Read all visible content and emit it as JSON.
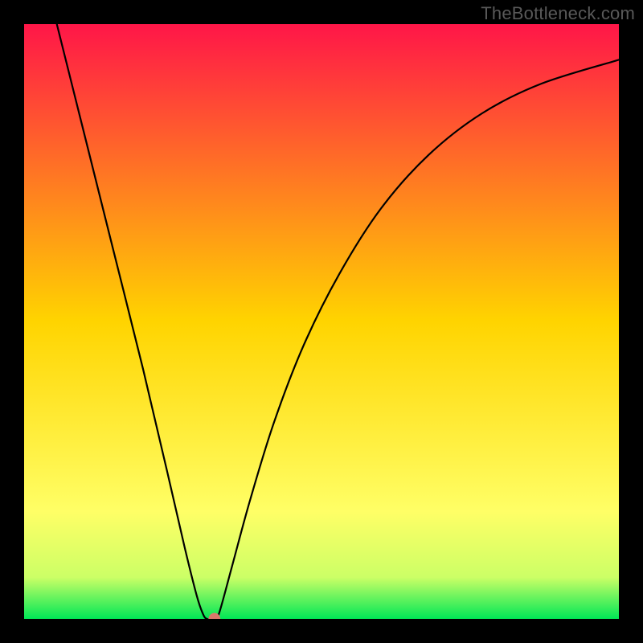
{
  "watermark": "TheBottleneck.com",
  "chart_data": {
    "type": "line",
    "title": "",
    "xlabel": "",
    "ylabel": "",
    "xlim": [
      0,
      1
    ],
    "ylim": [
      0,
      1
    ],
    "background_gradient": {
      "stops": [
        {
          "offset": 0.0,
          "color": "#ff1648"
        },
        {
          "offset": 0.5,
          "color": "#ffd400"
        },
        {
          "offset": 0.82,
          "color": "#ffff66"
        },
        {
          "offset": 0.93,
          "color": "#ccff66"
        },
        {
          "offset": 1.0,
          "color": "#00e756"
        }
      ]
    },
    "series": [
      {
        "name": "bottleneck-curve",
        "color": "#000000",
        "points": [
          {
            "x": 0.055,
            "y": 1.0
          },
          {
            "x": 0.1,
            "y": 0.82
          },
          {
            "x": 0.15,
            "y": 0.62
          },
          {
            "x": 0.2,
            "y": 0.42
          },
          {
            "x": 0.24,
            "y": 0.25
          },
          {
            "x": 0.27,
            "y": 0.12
          },
          {
            "x": 0.29,
            "y": 0.04
          },
          {
            "x": 0.3,
            "y": 0.01
          },
          {
            "x": 0.307,
            "y": 0.0
          },
          {
            "x": 0.32,
            "y": 0.0
          },
          {
            "x": 0.328,
            "y": 0.01
          },
          {
            "x": 0.35,
            "y": 0.09
          },
          {
            "x": 0.38,
            "y": 0.2
          },
          {
            "x": 0.42,
            "y": 0.33
          },
          {
            "x": 0.47,
            "y": 0.46
          },
          {
            "x": 0.53,
            "y": 0.58
          },
          {
            "x": 0.6,
            "y": 0.69
          },
          {
            "x": 0.68,
            "y": 0.78
          },
          {
            "x": 0.77,
            "y": 0.85
          },
          {
            "x": 0.87,
            "y": 0.9
          },
          {
            "x": 1.0,
            "y": 0.94
          }
        ]
      }
    ],
    "marker": {
      "x": 0.32,
      "y": 0.0,
      "r": 0.01,
      "color": "#d9776a"
    }
  }
}
